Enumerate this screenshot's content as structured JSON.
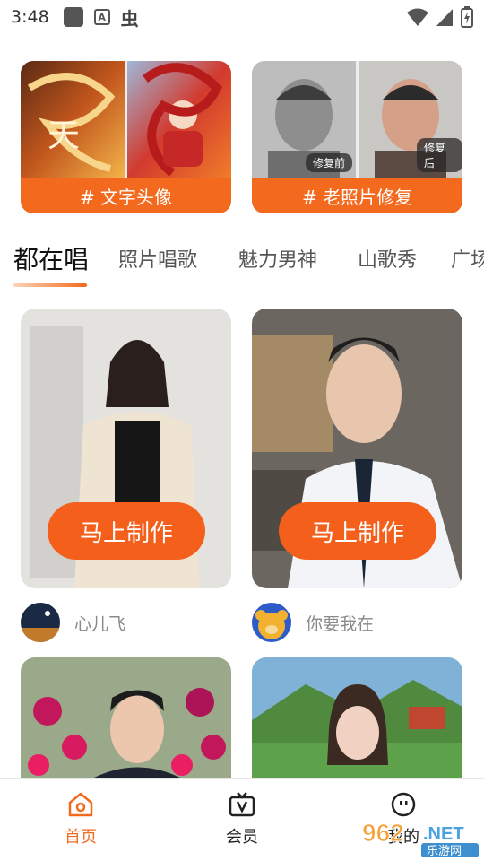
{
  "status_bar": {
    "time": "3:48",
    "a_glyph": "A",
    "bug_glyph": "虫"
  },
  "banners": [
    {
      "tag": "# 文字头像",
      "icon": "dragon-art-image"
    },
    {
      "tag": "# 老照片修复",
      "before_label": "修复前",
      "after_label": "修复后",
      "icon": "portrait-compare-image"
    }
  ],
  "tabs": [
    "都在唱",
    "照片唱歌",
    "魅力男神",
    "山歌秀",
    "广场"
  ],
  "cards": [
    {
      "button": "马上制作",
      "author": "心儿飞"
    },
    {
      "button": "马上制作",
      "author": "你要我在"
    }
  ],
  "nav": [
    {
      "label": "首页",
      "icon": "home-icon",
      "active": true
    },
    {
      "label": "会员",
      "icon": "vip-tv-icon",
      "active": false
    },
    {
      "label": "我的",
      "icon": "profile-face-icon",
      "active": false
    }
  ],
  "watermark": {
    "number": "962",
    "suffix": ".NET",
    "sub": "乐游网"
  },
  "colors": {
    "accent": "#f36a1e",
    "button": "#f45f1c"
  }
}
